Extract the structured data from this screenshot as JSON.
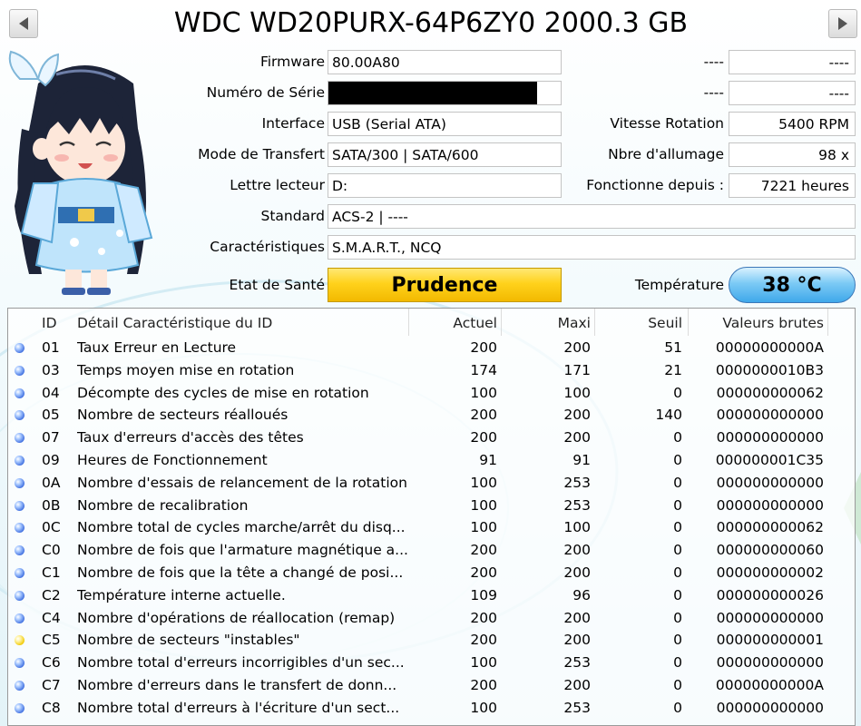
{
  "window": {
    "title": "WDC WD20PURX-64P6ZY0 2000.3 GB",
    "prev_icon": "triangle-left-icon",
    "next_icon": "triangle-right-icon"
  },
  "info": {
    "firmware_label": "Firmware",
    "firmware_value": "80.00A80",
    "serial_label": "Numéro de Série",
    "serial_value": "",
    "interface_label": "Interface",
    "interface_value": "USB (Serial ATA)",
    "transfer_label": "Mode de Transfert",
    "transfer_value": "SATA/300 | SATA/600",
    "drive_letter_label": "Lettre lecteur",
    "drive_letter_value": "D:",
    "standard_label": "Standard",
    "standard_value": "ACS-2 | ----",
    "features_label": "Caractéristiques",
    "features_value": "S.M.A.R.T., NCQ",
    "right_label_1": "----",
    "right_value_1": "----",
    "right_label_2": "----",
    "right_value_2": "----",
    "rotation_label": "Vitesse Rotation",
    "rotation_value": "5400 RPM",
    "power_count_label": "Nbre d'allumage",
    "power_count_value": "98 x",
    "power_hours_label": "Fonctionne depuis :",
    "power_hours_value": "7221 heures"
  },
  "status": {
    "health_label": "Etat de Santé",
    "health_value": "Prudence",
    "temperature_label": "Température",
    "temperature_value": "38 °C",
    "colors": {
      "caution": "#ffd21c",
      "temperature": "#62bdf0",
      "good_dot": "#3f6fe0",
      "caution_dot": "#f0c800"
    }
  },
  "smart_table": {
    "headers": [
      "ID",
      "Détail Caractéristique du ID",
      "Actuel",
      "Maxi",
      "Seuil",
      "Valeurs brutes"
    ],
    "rows": [
      {
        "status": "good",
        "id": "01",
        "name": "Taux Erreur en Lecture",
        "current": "200",
        "worst": "200",
        "threshold": "51",
        "raw": "00000000000A"
      },
      {
        "status": "good",
        "id": "03",
        "name": "Temps moyen mise en rotation",
        "current": "174",
        "worst": "171",
        "threshold": "21",
        "raw": "0000000010B3"
      },
      {
        "status": "good",
        "id": "04",
        "name": "Décompte des cycles de mise en rotation",
        "current": "100",
        "worst": "100",
        "threshold": "0",
        "raw": "000000000062"
      },
      {
        "status": "good",
        "id": "05",
        "name": "Nombre de secteurs réalloués",
        "current": "200",
        "worst": "200",
        "threshold": "140",
        "raw": "000000000000"
      },
      {
        "status": "good",
        "id": "07",
        "name": "Taux d'erreurs d'accès des têtes",
        "current": "200",
        "worst": "200",
        "threshold": "0",
        "raw": "000000000000"
      },
      {
        "status": "good",
        "id": "09",
        "name": "Heures de Fonctionnement",
        "current": "91",
        "worst": "91",
        "threshold": "0",
        "raw": "000000001C35"
      },
      {
        "status": "good",
        "id": "0A",
        "name": "Nombre d'essais de relancement de la rotation",
        "current": "100",
        "worst": "253",
        "threshold": "0",
        "raw": "000000000000"
      },
      {
        "status": "good",
        "id": "0B",
        "name": "Nombre de recalibration",
        "current": "100",
        "worst": "253",
        "threshold": "0",
        "raw": "000000000000"
      },
      {
        "status": "good",
        "id": "0C",
        "name": "Nombre total de cycles marche/arrêt du disq...",
        "current": "100",
        "worst": "100",
        "threshold": "0",
        "raw": "000000000062"
      },
      {
        "status": "good",
        "id": "C0",
        "name": "Nombre de fois que l'armature magnétique a...",
        "current": "200",
        "worst": "200",
        "threshold": "0",
        "raw": "000000000060"
      },
      {
        "status": "good",
        "id": "C1",
        "name": "Nombre de fois que la tête a changé de posi...",
        "current": "200",
        "worst": "200",
        "threshold": "0",
        "raw": "000000000002"
      },
      {
        "status": "good",
        "id": "C2",
        "name": "Température interne actuelle.",
        "current": "109",
        "worst": "96",
        "threshold": "0",
        "raw": "000000000026"
      },
      {
        "status": "good",
        "id": "C4",
        "name": "Nombre d'opérations de réallocation (remap)",
        "current": "200",
        "worst": "200",
        "threshold": "0",
        "raw": "000000000000"
      },
      {
        "status": "caution",
        "id": "C5",
        "name": "Nombre de secteurs \"instables\"",
        "current": "200",
        "worst": "200",
        "threshold": "0",
        "raw": "000000000001"
      },
      {
        "status": "good",
        "id": "C6",
        "name": "Nombre total d'erreurs incorrigibles d'un sec...",
        "current": "100",
        "worst": "253",
        "threshold": "0",
        "raw": "000000000000"
      },
      {
        "status": "good",
        "id": "C7",
        "name": "Nombre d'erreurs dans le transfert de donn...",
        "current": "200",
        "worst": "200",
        "threshold": "0",
        "raw": "00000000000A"
      },
      {
        "status": "good",
        "id": "C8",
        "name": "Nombre total d'erreurs à l'écriture d'un sect...",
        "current": "100",
        "worst": "253",
        "threshold": "0",
        "raw": "000000000000"
      }
    ]
  }
}
